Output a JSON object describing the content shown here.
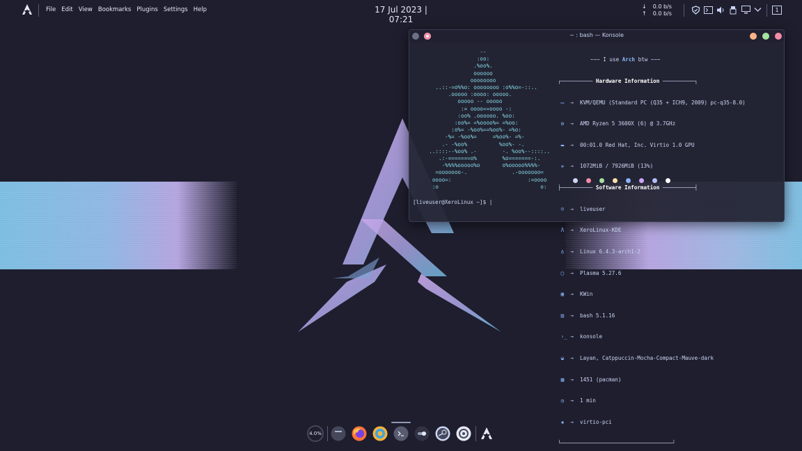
{
  "panel": {
    "menu": [
      "File",
      "Edit",
      "View",
      "Bookmarks",
      "Plugins",
      "Settings",
      "Help"
    ],
    "clock": "17 Jul 2023 | 07:21",
    "net_down": "0.0 b/s",
    "net_up": "0.0 b/s",
    "desktop_number": "1"
  },
  "konsole": {
    "title": "~ : bash — Konsole",
    "fetch_header_pre": "~~~ I use ",
    "fetch_header_accent": "Arch",
    "fetch_header_post": " btw ~~~",
    "hardware_heading": "Hardware Information",
    "software_heading": "Software Information",
    "hardware": [
      "KVM/QEMU (Standard PC (Q35 + ICH9, 2009) pc-q35-8.0)",
      "AMD Ryzen 5 3600X (6) @ 3.7GHz",
      "00:01.0 Red Hat, Inc. Virtio 1.0 GPU",
      "1072MiB / 7926MiB (13%)"
    ],
    "software": [
      "liveuser",
      "XeroLinux-KDE",
      "Linux 6.4.3-arch1-2",
      "Plasma 5.27.6",
      "KWin",
      "bash 5.1.16",
      "konsole",
      "Layan, Catppuccin-Mocha-Compact-Mauve-dark",
      "1451 (pacman)",
      "1 min",
      "virtio-pci"
    ],
    "palette": [
      "#cdd6f4",
      "#f38ba8",
      "#a6e3a1",
      "#f9e2af",
      "#89b4fa",
      "#cba6f7",
      "#b4befe",
      "#ffffff"
    ],
    "prompt": "[liveuser@XeroLinux ~]$ "
  },
  "dock": {
    "cpu_label": "4.0%"
  }
}
